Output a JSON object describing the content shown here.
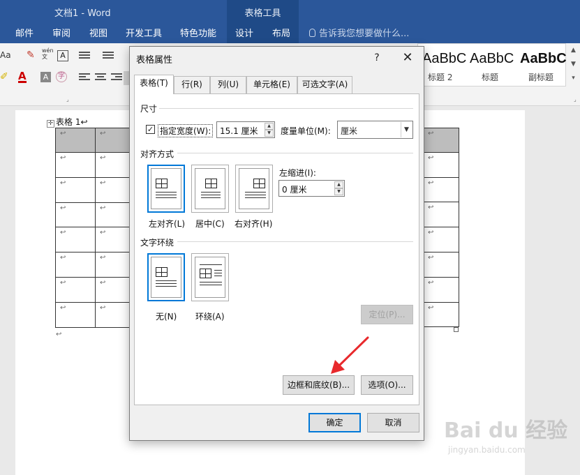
{
  "window": {
    "doc_title": "文档1 - Word",
    "context_group": "表格工具"
  },
  "ribbon_tabs": [
    {
      "label": "邮件"
    },
    {
      "label": "审阅"
    },
    {
      "label": "视图"
    },
    {
      "label": "开发工具"
    },
    {
      "label": "特色功能"
    },
    {
      "label": "设计"
    },
    {
      "label": "布局"
    }
  ],
  "tell_me": "告诉我您想要做什么...",
  "ribbon": {
    "font_case": "Aa",
    "wen": "wén 文",
    "a_box": "A",
    "styles": [
      {
        "sample": "AaBbC",
        "name": "标题 2"
      },
      {
        "sample": "AaBbC",
        "name": "标题"
      },
      {
        "sample": "AaBbC",
        "name": "副标题"
      }
    ]
  },
  "document": {
    "caption": "表格 1↩",
    "para_mark": "↩",
    "move_handle": "✛",
    "table_rows": 8
  },
  "dialog": {
    "title": "表格属性",
    "help": "?",
    "close": "✕",
    "tabs": [
      {
        "label": "表格(T)",
        "active": true
      },
      {
        "label": "行(R)",
        "active": false
      },
      {
        "label": "列(U)",
        "active": false
      },
      {
        "label": "单元格(E)",
        "active": false
      },
      {
        "label": "可选文字(A)",
        "active": false
      }
    ],
    "size_section": "尺寸",
    "preferred_width_checked": true,
    "preferred_width_label": "指定宽度(W):",
    "preferred_width_value": "15.1 厘米",
    "unit_label": "度量单位(M):",
    "unit_value": "厘米",
    "alignment_section": "对齐方式",
    "alignment_options": [
      {
        "label": "左对齐(L)",
        "selected": true
      },
      {
        "label": "居中(C)",
        "selected": false
      },
      {
        "label": "右对齐(H)",
        "selected": false
      }
    ],
    "indent_label": "左缩进(I):",
    "indent_value": "0 厘米",
    "wrap_section": "文字环绕",
    "wrap_options": [
      {
        "label": "无(N)",
        "selected": true
      },
      {
        "label": "环绕(A)",
        "selected": false
      }
    ],
    "position_button": "定位(P)...",
    "borders_button": "边框和底纹(B)...",
    "options_button": "选项(O)...",
    "ok_button": "确定",
    "cancel_button": "取消"
  },
  "watermark": {
    "text": "Bai du 经验",
    "url": "jingyan.baidu.com"
  },
  "colors": {
    "ribbon_blue": "#2b579a",
    "accent": "#0078d7",
    "arrow_red": "#e8292c"
  }
}
